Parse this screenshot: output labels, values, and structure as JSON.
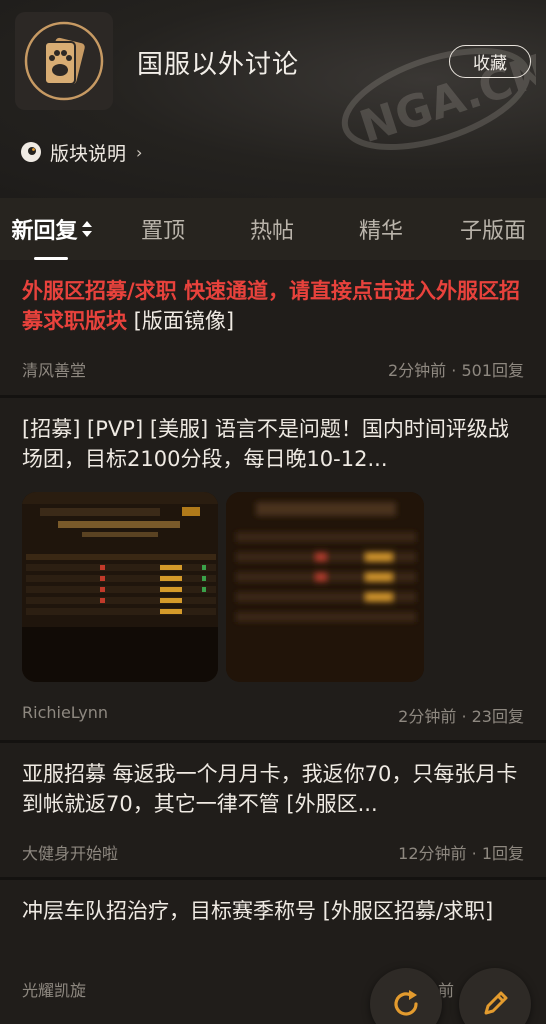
{
  "header": {
    "forum_title": "国服以外讨论",
    "favorite_label": "收藏",
    "board_desc_label": "版块说明",
    "board_desc_chevron": "›"
  },
  "tabs": [
    {
      "label": "新回复",
      "active": true
    },
    {
      "label": "置顶"
    },
    {
      "label": "热帖"
    },
    {
      "label": "精华"
    },
    {
      "label": "子版面"
    }
  ],
  "posts": [
    {
      "title_red": "外服区招募/求职 快速通道，请直接点击进入外服区招募求职版块",
      "title_tail": " [版面镜像]",
      "author": "清风善堂",
      "time": "2分钟前",
      "replies": "501回复"
    },
    {
      "title": "[招募] [PVP] [美服] 语言不是问题！国内时间评级战场团，目标2100分段，每日晚10-12...",
      "author": "RichieLynn",
      "time": "2分钟前",
      "replies": "23回复",
      "images": [
        "thumb-leaderboard",
        "thumb-leaderboard-blurred"
      ]
    },
    {
      "title": "亚服招募 每返我一个月月卡，我返你70，只每张月卡到帐就返70，其它一律不管 [外服区...",
      "author": "大健身开始啦",
      "time": "12分钟前",
      "replies": "1回复"
    },
    {
      "title": "冲层车队招治疗，目标赛季称号 [外服区招募/求职]",
      "author": "光耀凯旋",
      "time": "前",
      "replies": ""
    }
  ],
  "meta_dot": "·",
  "fab": {
    "refresh_icon": "refresh-icon",
    "compose_icon": "pencil-icon",
    "accent": "#e39b2e"
  },
  "colors": {
    "background": "#1b1918",
    "card": "#201d1a",
    "highlight_red": "#e8423c"
  }
}
